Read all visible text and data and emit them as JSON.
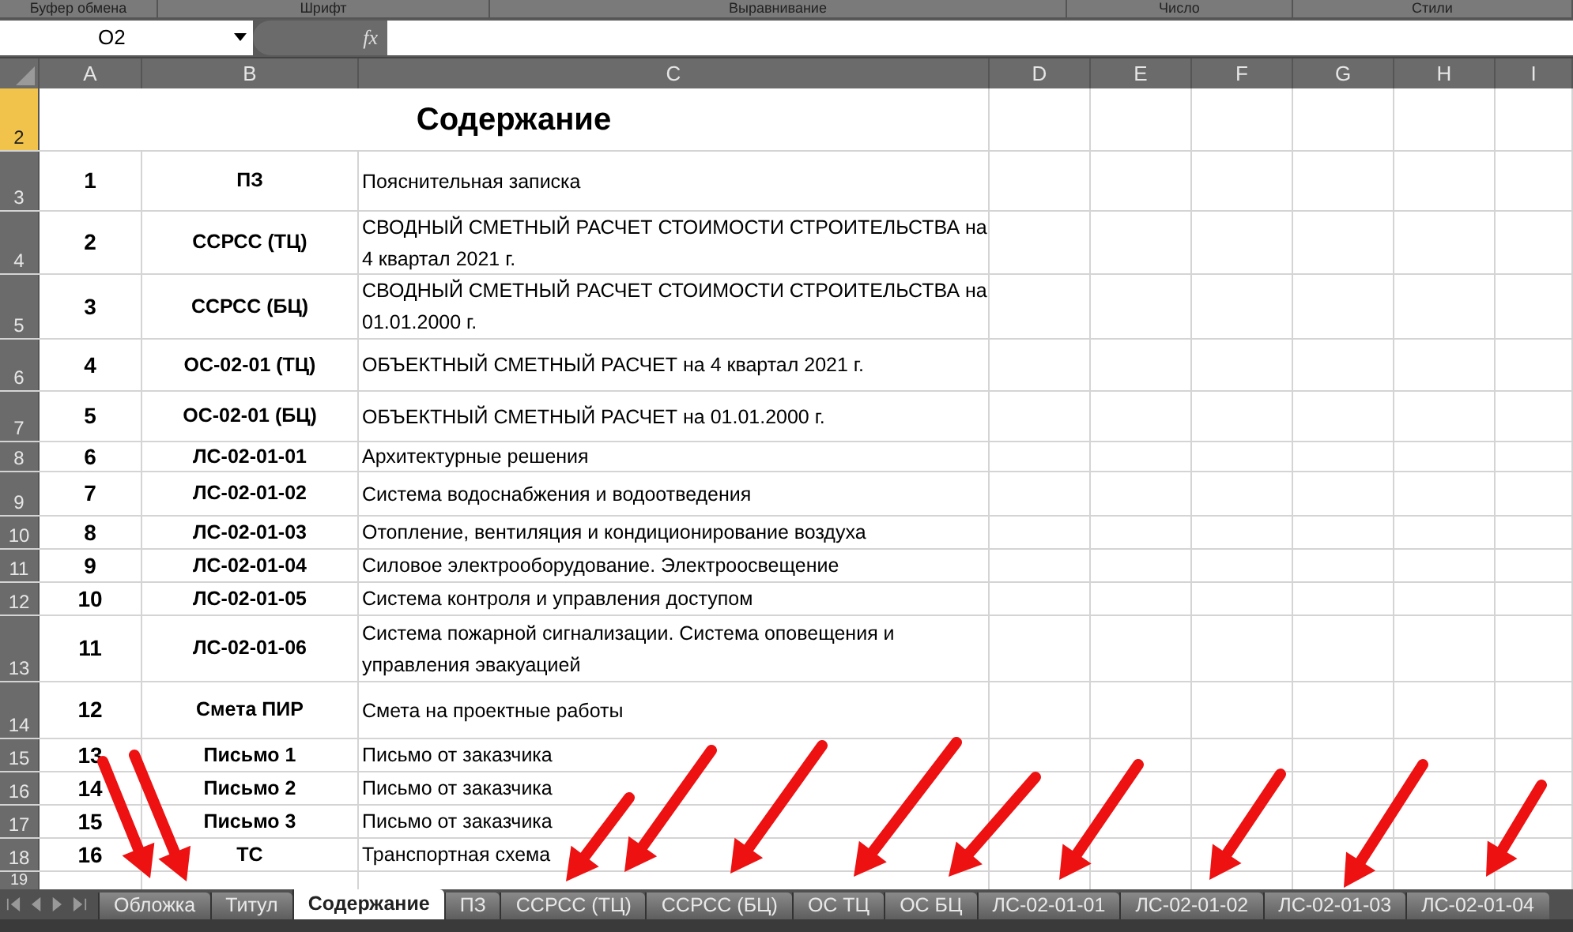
{
  "ribbon_groups": [
    "Буфер обмена",
    "Шрифт",
    "Выравнивание",
    "Число",
    "Стили"
  ],
  "name_box": "O2",
  "formula_label": "fx",
  "columns": [
    "A",
    "B",
    "C",
    "D",
    "E",
    "F",
    "G",
    "H",
    "I"
  ],
  "rows": [
    {
      "number": "2",
      "selected": true,
      "kind": "title",
      "title": "Содержание"
    },
    {
      "number": "3",
      "selected": false,
      "kind": "entry",
      "cells": [
        "1",
        "ПЗ",
        "Пояснительная записка"
      ]
    },
    {
      "number": "4",
      "selected": false,
      "kind": "entry",
      "cells": [
        "2",
        "ССРСС (ТЦ)",
        "СВОДНЫЙ СМЕТНЫЙ РАСЧЕТ СТОИМОСТИ СТРОИТЕЛЬСТВА на 4 квартал 2021 г."
      ]
    },
    {
      "number": "5",
      "selected": false,
      "kind": "entry",
      "cells": [
        "3",
        "ССРСС (БЦ)",
        "СВОДНЫЙ СМЕТНЫЙ РАСЧЕТ СТОИМОСТИ СТРОИТЕЛЬСТВА на 01.01.2000 г."
      ]
    },
    {
      "number": "6",
      "selected": false,
      "kind": "entry",
      "cells": [
        "4",
        "ОС-02-01 (ТЦ)",
        "ОБЪЕКТНЫЙ СМЕТНЫЙ РАСЧЕТ на 4 квартал 2021 г."
      ]
    },
    {
      "number": "7",
      "selected": false,
      "kind": "entry",
      "cells": [
        "5",
        "ОС-02-01 (БЦ)",
        "ОБЪЕКТНЫЙ СМЕТНЫЙ РАСЧЕТ на 01.01.2000 г."
      ]
    },
    {
      "number": "8",
      "selected": false,
      "kind": "entry",
      "cells": [
        "6",
        "ЛС-02-01-01",
        "Архитектурные решения"
      ]
    },
    {
      "number": "9",
      "selected": false,
      "kind": "entry",
      "cells": [
        "7",
        "ЛС-02-01-02",
        "Система водоснабжения и водоотведения"
      ]
    },
    {
      "number": "10",
      "selected": false,
      "kind": "entry",
      "cells": [
        "8",
        "ЛС-02-01-03",
        "Отопление, вентиляция и кондиционирование воздуха"
      ]
    },
    {
      "number": "11",
      "selected": false,
      "kind": "entry",
      "cells": [
        "9",
        "ЛС-02-01-04",
        "Силовое электрооборудование. Электроосвещение"
      ]
    },
    {
      "number": "12",
      "selected": false,
      "kind": "entry",
      "cells": [
        "10",
        "ЛС-02-01-05",
        "Система контроля и управления доступом"
      ]
    },
    {
      "number": "13",
      "selected": false,
      "kind": "entry",
      "cells": [
        "11",
        "ЛС-02-01-06",
        "Система пожарной сигнализации. Система оповещения и управления эвакуацией"
      ]
    },
    {
      "number": "14",
      "selected": false,
      "kind": "entry",
      "cells": [
        "12",
        "Смета ПИР",
        "Смета на проектные работы"
      ]
    },
    {
      "number": "15",
      "selected": false,
      "kind": "entry",
      "cells": [
        "13",
        "Письмо 1",
        "Письмо от заказчика"
      ]
    },
    {
      "number": "16",
      "selected": false,
      "kind": "entry",
      "cells": [
        "14",
        "Письмо 2",
        "Письмо от заказчика"
      ]
    },
    {
      "number": "17",
      "selected": false,
      "kind": "entry",
      "cells": [
        "15",
        "Письмо 3",
        "Письмо от заказчика"
      ]
    },
    {
      "number": "18",
      "selected": false,
      "kind": "entry",
      "cells": [
        "16",
        "ТС",
        "Транспортная схема"
      ]
    },
    {
      "number": "19",
      "selected": false,
      "kind": "blank"
    }
  ],
  "sheet_tabs": [
    {
      "label": "Обложка",
      "selected": false
    },
    {
      "label": "Титул",
      "selected": false
    },
    {
      "label": "Содержание",
      "selected": true
    },
    {
      "label": "ПЗ",
      "selected": false
    },
    {
      "label": "ССРСС (ТЦ)",
      "selected": false
    },
    {
      "label": "ССРСС (БЦ)",
      "selected": false
    },
    {
      "label": "ОС ТЦ",
      "selected": false
    },
    {
      "label": "ОС БЦ",
      "selected": false
    },
    {
      "label": "ЛС-02-01-01",
      "selected": false
    },
    {
      "label": "ЛС-02-01-02",
      "selected": false
    },
    {
      "label": "ЛС-02-01-03",
      "selected": false
    },
    {
      "label": "ЛС-02-01-04",
      "selected": false
    }
  ]
}
